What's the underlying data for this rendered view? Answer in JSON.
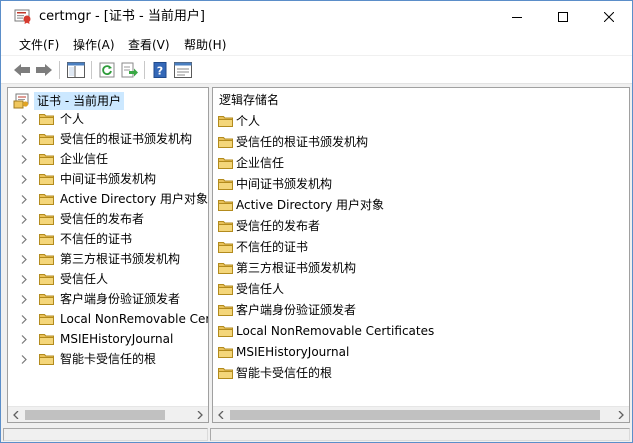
{
  "window": {
    "title": "certmgr - [证书 - 当前用户]"
  },
  "menu": {
    "items": [
      {
        "label": "文件(F)"
      },
      {
        "label": "操作(A)"
      },
      {
        "label": "查看(V)"
      },
      {
        "label": "帮助(H)"
      }
    ]
  },
  "toolbar": {
    "buttons": [
      "back-arrow-icon",
      "forward-arrow-icon",
      "show-hide-tree-icon",
      "refresh-icon",
      "export-list-icon",
      "help-icon",
      "properties-icon"
    ]
  },
  "tree": {
    "root_label": "证书 - 当前用户",
    "items": [
      {
        "label": "个人"
      },
      {
        "label": "受信任的根证书颁发机构"
      },
      {
        "label": "企业信任"
      },
      {
        "label": "中间证书颁发机构"
      },
      {
        "label": "Active Directory 用户对象"
      },
      {
        "label": "受信任的发布者"
      },
      {
        "label": "不信任的证书"
      },
      {
        "label": "第三方根证书颁发机构"
      },
      {
        "label": "受信任人"
      },
      {
        "label": "客户端身份验证颁发者"
      },
      {
        "label": "Local NonRemovable Cert"
      },
      {
        "label": "MSIEHistoryJournal"
      },
      {
        "label": "智能卡受信任的根"
      }
    ]
  },
  "list": {
    "header": "逻辑存储名",
    "items": [
      {
        "label": "个人"
      },
      {
        "label": "受信任的根证书颁发机构"
      },
      {
        "label": "企业信任"
      },
      {
        "label": "中间证书颁发机构"
      },
      {
        "label": "Active Directory 用户对象"
      },
      {
        "label": "受信任的发布者"
      },
      {
        "label": "不信任的证书"
      },
      {
        "label": "第三方根证书颁发机构"
      },
      {
        "label": "受信任人"
      },
      {
        "label": "客户端身份验证颁发者"
      },
      {
        "label": "Local NonRemovable Certificates"
      },
      {
        "label": "MSIEHistoryJournal"
      },
      {
        "label": "智能卡受信任的根"
      }
    ]
  },
  "colors": {
    "selection": "#cce8ff",
    "folder": "#e8c15a",
    "window_border": "#5b8ec9"
  }
}
